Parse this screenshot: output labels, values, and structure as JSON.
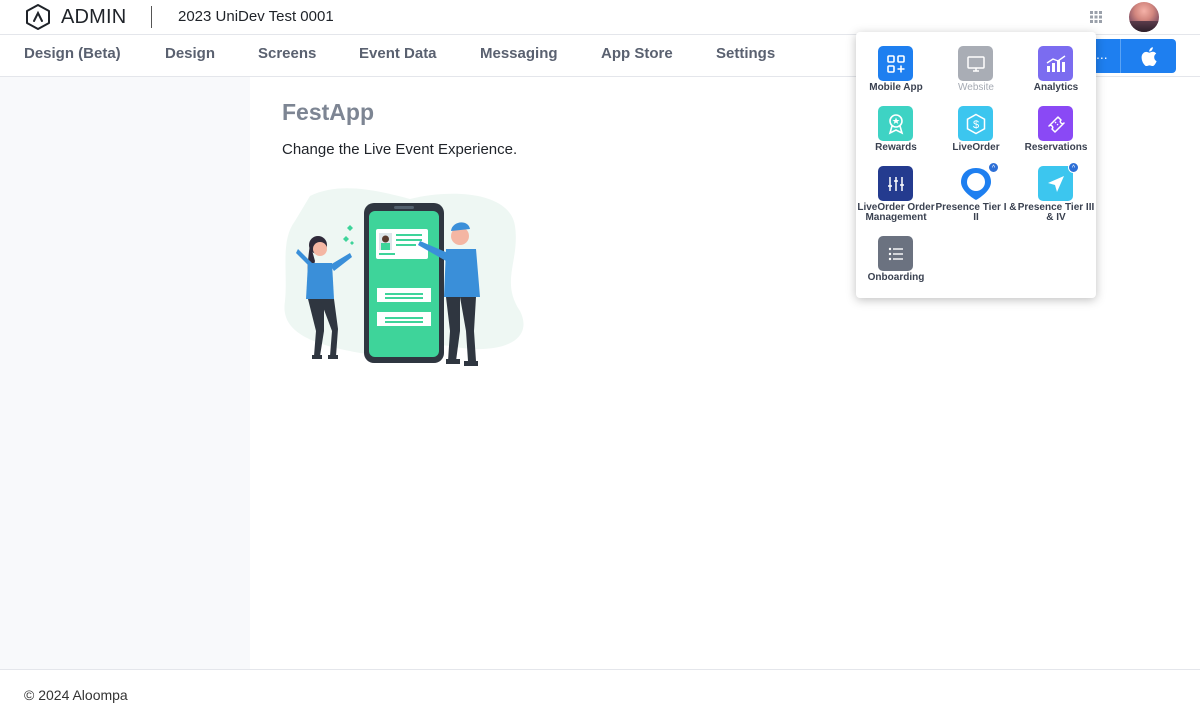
{
  "header": {
    "logo_text": "ADMIN",
    "project_title": "2023 UniDev Test 0001"
  },
  "nav": {
    "items": [
      "Design (Beta)",
      "Design",
      "Screens",
      "Event Data",
      "Messaging",
      "App Store",
      "Settings"
    ],
    "more_label": "..."
  },
  "main": {
    "app_name": "FestApp",
    "tagline": "Change the Live Event Experience."
  },
  "apps_menu": {
    "items": [
      {
        "label": "Mobile App",
        "icon": "mobile-app-icon",
        "color": "#1e7ff0"
      },
      {
        "label": "Website",
        "icon": "website-icon",
        "color": "#a9adb5"
      },
      {
        "label": "Analytics",
        "icon": "analytics-icon",
        "color": "#7b6cf0"
      },
      {
        "label": "Rewards",
        "icon": "rewards-icon",
        "color": "#3ed3c4"
      },
      {
        "label": "LiveOrder",
        "icon": "liveorder-icon",
        "color": "#3cc6ef"
      },
      {
        "label": "Reservations",
        "icon": "reservations-icon",
        "color": "#8a49f5"
      },
      {
        "label": "LiveOrder Order Management",
        "icon": "order-management-icon",
        "color": "#243b8f"
      },
      {
        "label": "Presence Tier I & II",
        "icon": "presence-pin-icon",
        "color": "#1e7ff0"
      },
      {
        "label": "Presence Tier III & IV",
        "icon": "presence-navigation-icon",
        "color": "#3cc6ef"
      },
      {
        "label": "Onboarding",
        "icon": "onboarding-icon",
        "color": "#6b7280"
      }
    ]
  },
  "footer": {
    "copyright": "© 2024 Aloompa"
  },
  "colors": {
    "primary": "#1e7ff0",
    "nav_text": "#5a6170",
    "app_name": "#7d8593"
  }
}
